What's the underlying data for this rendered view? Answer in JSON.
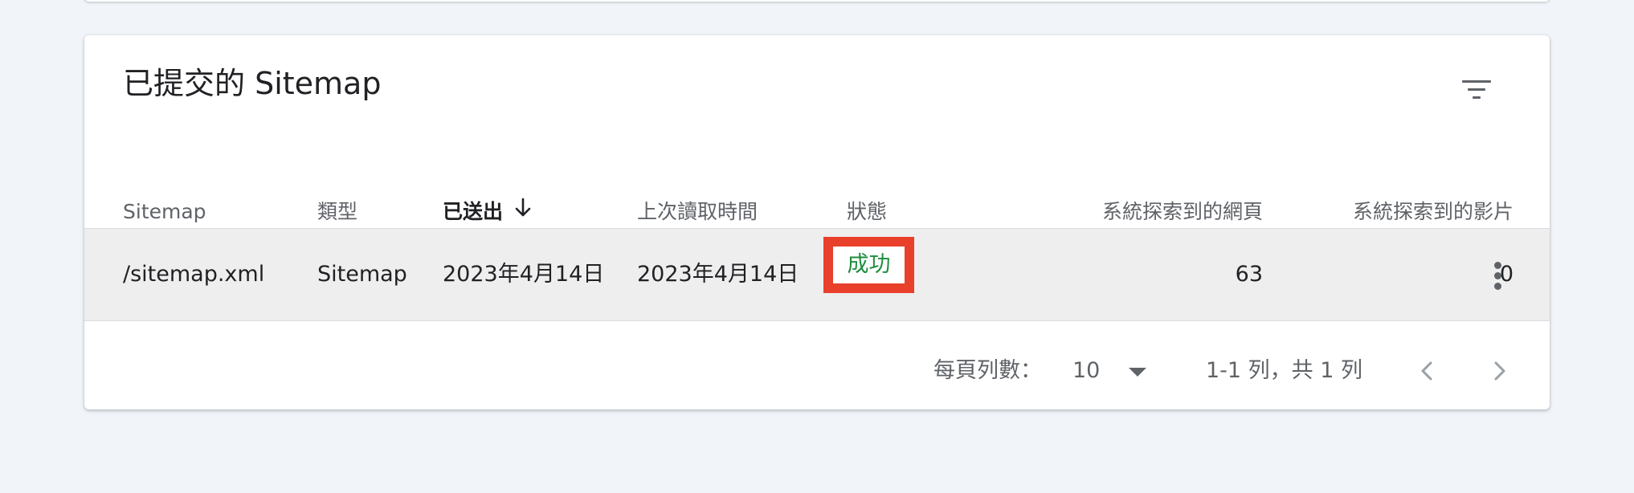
{
  "card": {
    "title": "已提交的 Sitemap",
    "filter_icon": "filter-list-icon"
  },
  "table": {
    "columns": [
      {
        "label": "Sitemap"
      },
      {
        "label": "類型"
      },
      {
        "label": "已送出",
        "sorted": "descending",
        "sort_icon": "arrow-down-icon"
      },
      {
        "label": "上次讀取時間"
      },
      {
        "label": "狀態"
      },
      {
        "label": "系統探索到的網頁"
      },
      {
        "label": "系統探索到的影片"
      }
    ],
    "rows": [
      {
        "sitemap": "/sitemap.xml",
        "type": "Sitemap",
        "submitted": "2023年4月14日",
        "last_read": "2023年4月14日",
        "status": "成功",
        "pages": "63",
        "videos": "0",
        "more_icon": "more-vert-icon"
      }
    ]
  },
  "pagination": {
    "rows_per_page_label": "每頁列數：",
    "rows_per_page_value": "10",
    "range_text": "1-1 列，共 1 列",
    "prev_icon": "chevron-left-icon",
    "next_icon": "chevron-right-icon"
  },
  "colors": {
    "status_success_text": "#1e8e3e",
    "highlight_border": "#e8402a",
    "row_background": "#eeeeee",
    "page_background": "#f1f4f9"
  }
}
